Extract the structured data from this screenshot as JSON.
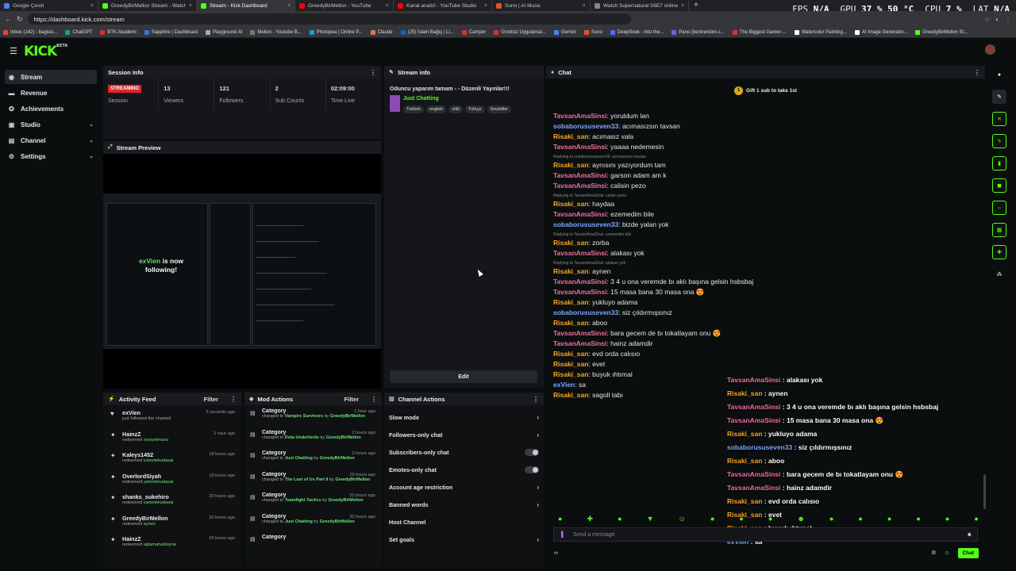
{
  "browser": {
    "tabs": [
      {
        "title": "Google Çeviri",
        "color": "#4285f4",
        "active": false
      },
      {
        "title": "GreedyBirMellon Stream - Watch",
        "color": "#53fc18",
        "active": false
      },
      {
        "title": "Stream - Kick Dashboard",
        "color": "#53fc18",
        "active": true
      },
      {
        "title": "GreedyBirMellon - YouTube",
        "color": "#ff0000",
        "active": false
      },
      {
        "title": "Kanal analizi - YouTube Studio",
        "color": "#ff0000",
        "active": false
      },
      {
        "title": "Suno | AI Music",
        "color": "#e0542b",
        "active": false
      },
      {
        "title": "Watch Supernatural S6E7 online",
        "color": "#888888",
        "active": false
      }
    ],
    "url": "https://dashboard.kick.com/stream",
    "perf": {
      "fps_label": "FPS",
      "fps": "N/A",
      "gpu_label": "GPU",
      "gpu": "37 % 50 °C",
      "cpu_label": "CPU",
      "cpu": "7 %",
      "lat_label": "LAT",
      "lat": "N/A"
    },
    "bookmarks": [
      {
        "label": "Inbox (142) - bagisis...",
        "color": "#ea4335"
      },
      {
        "label": "ChatGPT",
        "color": "#10a37f"
      },
      {
        "label": "BTK Akademi",
        "color": "#d9302d"
      },
      {
        "label": "Sapphire | Dashboard",
        "color": "#3b6fe0"
      },
      {
        "label": "Playground AI",
        "color": "#aaaaaa"
      },
      {
        "label": "Mellon - Youtube B...",
        "color": "#777777"
      },
      {
        "label": "Photopea | Online P...",
        "color": "#1aa0c8"
      },
      {
        "label": "Claude",
        "color": "#d97757"
      },
      {
        "label": "(25) İslam Bağış | Li...",
        "color": "#0a66c2"
      },
      {
        "label": "Camper",
        "color": "#d9302d"
      },
      {
        "label": "Ücretsiz Uygulamal...",
        "color": "#d9302d"
      },
      {
        "label": "Gemini",
        "color": "#4285f4"
      },
      {
        "label": "Suno",
        "color": "#e0542b"
      },
      {
        "label": "DeepSeek - Into the...",
        "color": "#4d6bfe"
      },
      {
        "label": "Pano (bentrendim.c...",
        "color": "#7a5af8"
      },
      {
        "label": "The Biggest Gamer-...",
        "color": "#d9302d"
      },
      {
        "label": "Watercolor Painting...",
        "color": "#ffffff"
      },
      {
        "label": "AI Image Generator...",
        "color": "#ffffff"
      },
      {
        "label": "GreedyBirMellon St...",
        "color": "#53fc18"
      }
    ]
  },
  "app": {
    "logo": "KICK",
    "logo_tag": "BETA"
  },
  "sidebar": [
    {
      "label": "Stream",
      "icon": "broadcast-icon",
      "glyph": "◉",
      "active": true,
      "expand": false
    },
    {
      "label": "Revenue",
      "icon": "revenue-icon",
      "glyph": "▬",
      "active": false,
      "expand": false
    },
    {
      "label": "Achievements",
      "icon": "trophy-icon",
      "glyph": "✪",
      "active": false,
      "expand": false
    },
    {
      "label": "Studio",
      "icon": "studio-icon",
      "glyph": "▣",
      "active": false,
      "expand": true
    },
    {
      "label": "Channel",
      "icon": "channel-icon",
      "glyph": "▤",
      "active": false,
      "expand": true
    },
    {
      "label": "Settings",
      "icon": "gear-icon",
      "glyph": "⚙",
      "active": false,
      "expand": true
    }
  ],
  "session": {
    "title": "Session Info",
    "badge": "STREAMING",
    "stats": [
      {
        "value": "",
        "label": "Session"
      },
      {
        "value": "13",
        "label": "Viewers"
      },
      {
        "value": "121",
        "label": "Followers"
      },
      {
        "value": "2",
        "label": "Sub Counts"
      },
      {
        "value": "02:09:00",
        "label": "Time Live"
      }
    ]
  },
  "preview": {
    "title": "Stream Preview",
    "alert_name": "exVien",
    "alert_text": "is now following!"
  },
  "streaminfo": {
    "title": "Stream info",
    "stream_title": "Oduncu yaparım tamam - - Düzenli Yayınlar!!!",
    "category": "Just Chatting",
    "tags": [
      "Turkish",
      "english",
      "chill",
      "Türkçe",
      "Soulslike"
    ],
    "edit": "Edit"
  },
  "chat": {
    "title": "Chat",
    "pinned": "Gift 1 sub to take 1st",
    "pinned_count": "1",
    "placeholder": "Send a message",
    "send": "Chat",
    "footer_symbol": "∞",
    "messages": [
      {
        "user": "TavsanAmaSinsi",
        "color": "#f26da0",
        "text": "yoruldum lan"
      },
      {
        "user": "sobaborususeven33",
        "color": "#7aa7ff",
        "text": "acımasızsın tavsan"
      },
      {
        "user": "Risaki_san",
        "color": "#f5a623",
        "text": "acımasız vala"
      },
      {
        "user": "TavsanAmaSinsi",
        "color": "#f26da0",
        "text": "yaaaa nedemesin"
      },
      {
        "reply": "Replying to sobaborususeven33: acımasızsın tavsan"
      },
      {
        "user": "Risaki_san",
        "color": "#f5a623",
        "text": "aynısını yazıyordum tam"
      },
      {
        "user": "TavsanAmaSinsi",
        "color": "#f26da0",
        "text": "garson adam am k"
      },
      {
        "user": "TavsanAmaSinsi",
        "color": "#f26da0",
        "text": "calisin pezo"
      },
      {
        "reply": "Replying to TavsanAmaSinsi: calisin pezo"
      },
      {
        "user": "Risaki_san",
        "color": "#f5a623",
        "text": "haydaa"
      },
      {
        "user": "TavsanAmaSinsi",
        "color": "#f26da0",
        "text": "ezemedim bile"
      },
      {
        "user": "sobaborususeven33",
        "color": "#7aa7ff",
        "text": "bizde yalan yok"
      },
      {
        "reply": "Replying to TavsanAmaSinsi: ezemedim bile"
      },
      {
        "user": "Risaki_san",
        "color": "#f5a623",
        "text": "zorba"
      },
      {
        "user": "TavsanAmaSinsi",
        "color": "#f26da0",
        "text": "alakası yok"
      },
      {
        "reply": "Replying to TavsanAmaSinsi: alakası yok"
      },
      {
        "user": "Risaki_san",
        "color": "#f5a623",
        "text": "aynen"
      },
      {
        "user": "TavsanAmaSinsi",
        "color": "#f26da0",
        "text": "3 4 u ona veremde bı aklı başına gelsin hsbsbaj"
      },
      {
        "user": "TavsanAmaSinsi",
        "color": "#f26da0",
        "text": "15 masa bana 30 masa ona 😍"
      },
      {
        "user": "Risaki_san",
        "color": "#f5a623",
        "text": "yukluyo adama"
      },
      {
        "user": "sobaborususeven33",
        "color": "#7aa7ff",
        "text": "siz çıldırmışsınız"
      },
      {
        "user": "Risaki_san",
        "color": "#f5a623",
        "text": "aboo"
      },
      {
        "user": "TavsanAmaSinsi",
        "color": "#f26da0",
        "text": "bara gecem de bı tokatlayam onu 😍"
      },
      {
        "user": "TavsanAmaSinsi",
        "color": "#f26da0",
        "text": "hainz adamdir"
      },
      {
        "user": "Risaki_san",
        "color": "#f5a623",
        "text": "evd orda calısıo"
      },
      {
        "user": "Risaki_san",
        "color": "#f5a623",
        "text": "evet"
      },
      {
        "user": "Risaki_san",
        "color": "#f5a623",
        "text": "buyuk ıhtımal"
      },
      {
        "user": "exVien",
        "color": "#7aa7ff",
        "text": "sa"
      },
      {
        "user": "Risaki_san",
        "color": "#f5a623",
        "text": "sagoll tabı"
      }
    ],
    "overlay": [
      {
        "user": "TavsanAmaSinsi",
        "color": "#f26da0",
        "text": "alakası yok"
      },
      {
        "user": "Risaki_san",
        "color": "#f5a623",
        "text": "aynen"
      },
      {
        "user": "TavsanAmaSinsi",
        "color": "#f26da0",
        "text": "3 4 u ona veremde bı aklı başına gelsin hsbsbaj"
      },
      {
        "user": "TavsanAmaSinsi",
        "color": "#f26da0",
        "text": "15 masa bana 30 masa ona 😍"
      },
      {
        "user": "Risaki_san",
        "color": "#f5a623",
        "text": "yukluyo adama"
      },
      {
        "user": "sobaborususeven33",
        "color": "#7aa7ff",
        "text": "siz çıldırmışsınız"
      },
      {
        "user": "Risaki_san",
        "color": "#f5a623",
        "text": "aboo"
      },
      {
        "user": "TavsanAmaSinsi",
        "color": "#f26da0",
        "text": "bara gecem de bı tokatlayam onu 😍"
      },
      {
        "user": "TavsanAmaSinsi",
        "color": "#f26da0",
        "text": "hainz adamdir"
      },
      {
        "user": "Risaki_san",
        "color": "#f5a623",
        "text": "evd orda calısıo"
      },
      {
        "user": "Risaki_san",
        "color": "#f5a623",
        "text": "evet"
      },
      {
        "user": "Risaki_san",
        "color": "#f5a623",
        "text": "buyuk ıhtımal"
      },
      {
        "user": "exVien",
        "color": "#7aa7ff",
        "text": "sa"
      }
    ]
  },
  "activity": {
    "title": "Activity Feed",
    "filter": "Filter",
    "items": [
      {
        "icon": "heart-icon",
        "glyph": "♥",
        "name": "exVien",
        "verb": "just followed the channel",
        "reward": "",
        "time": "5 seconds ago"
      },
      {
        "icon": "reward-icon",
        "glyph": "✦",
        "name": "HainzZ",
        "verb": "redeemed",
        "reward": "soviyetmarsi",
        "time": "1 hour ago"
      },
      {
        "icon": "reward-icon",
        "glyph": "✦",
        "name": "Kaleys1452",
        "verb": "redeemed",
        "reward": "yametekudasai",
        "time": "19 hours ago"
      },
      {
        "icon": "reward-icon",
        "glyph": "✦",
        "name": "OverlordSiyah",
        "verb": "redeemed",
        "reward": "yametekudasai",
        "time": "19 hours ago"
      },
      {
        "icon": "reward-icon",
        "glyph": "✦",
        "name": "shanks_sukehiro",
        "verb": "redeemed",
        "reward": "yametekudasai",
        "time": "20 hours ago"
      },
      {
        "icon": "reward-icon",
        "glyph": "✦",
        "name": "GreedyBirMellon",
        "verb": "redeemed",
        "reward": "aynen",
        "time": "20 hours ago"
      },
      {
        "icon": "reward-icon",
        "glyph": "✦",
        "name": "HainzZ",
        "verb": "redeemed",
        "reward": "aglamahadioyna",
        "time": "20 hours ago"
      }
    ]
  },
  "mod": {
    "title": "Mod Actions",
    "filter": "Filter",
    "items": [
      {
        "name": "Category",
        "prefix": "changed to ",
        "target": "Vampire Survivors",
        "by": " by ",
        "user": "GreedyBirMellon",
        "time": "1 hour ago"
      },
      {
        "name": "Category",
        "prefix": "changed to ",
        "target": "Dota Underlords",
        "by": " by ",
        "user": "GreedyBirMellon",
        "time": "2 hours ago"
      },
      {
        "name": "Category",
        "prefix": "changed to ",
        "target": "Just Chatting",
        "by": " by ",
        "user": "GreedyBirMellon",
        "time": "2 hours ago"
      },
      {
        "name": "Category",
        "prefix": "changed to ",
        "target": "The Last of Us Part II",
        "by": " by ",
        "user": "GreedyBirMellon",
        "time": "19 hours ago"
      },
      {
        "name": "Category",
        "prefix": "changed to ",
        "target": "Teamfight Tactics",
        "by": " by ",
        "user": "GreedyBirMellon",
        "time": "22 hours ago"
      },
      {
        "name": "Category",
        "prefix": "changed to ",
        "target": "Just Chatting",
        "by": " by ",
        "user": "GreedyBirMellon",
        "time": "22 hours ago"
      },
      {
        "name": "Category",
        "prefix": "",
        "target": "",
        "by": "",
        "user": "",
        "time": ""
      }
    ]
  },
  "channel_actions": {
    "title": "Channel Actions",
    "items": [
      {
        "label": "Slow mode",
        "kind": "arrow"
      },
      {
        "label": "Followers-only chat",
        "kind": "arrow"
      },
      {
        "label": "Subscribers-only chat",
        "kind": "toggle"
      },
      {
        "label": "Emotes-only chat",
        "kind": "toggle"
      },
      {
        "label": "Account age restriction",
        "kind": "arrow"
      },
      {
        "label": "Banned words",
        "kind": "arrow"
      },
      {
        "label": "Host Channel",
        "kind": "none"
      },
      {
        "label": "Set goals",
        "kind": "arrow"
      }
    ]
  },
  "rail": [
    {
      "icon": "info-icon",
      "glyph": "●",
      "style": "plain"
    },
    {
      "icon": "pencil-icon",
      "glyph": "✎",
      "style": "d"
    },
    {
      "icon": "crosshair-icon",
      "glyph": "✕",
      "style": "g"
    },
    {
      "icon": "bolt-icon",
      "glyph": "ϟ",
      "style": "g"
    },
    {
      "icon": "trash-icon",
      "glyph": "▮",
      "style": "g"
    },
    {
      "icon": "chat-icon",
      "glyph": "◼",
      "style": "g"
    },
    {
      "icon": "link-icon",
      "glyph": "⇔",
      "style": "g"
    },
    {
      "icon": "save-icon",
      "glyph": "▦",
      "style": "g"
    },
    {
      "icon": "wrench-icon",
      "glyph": "✚",
      "style": "g"
    },
    {
      "icon": "group-icon",
      "glyph": "⁂",
      "style": "plain"
    }
  ]
}
